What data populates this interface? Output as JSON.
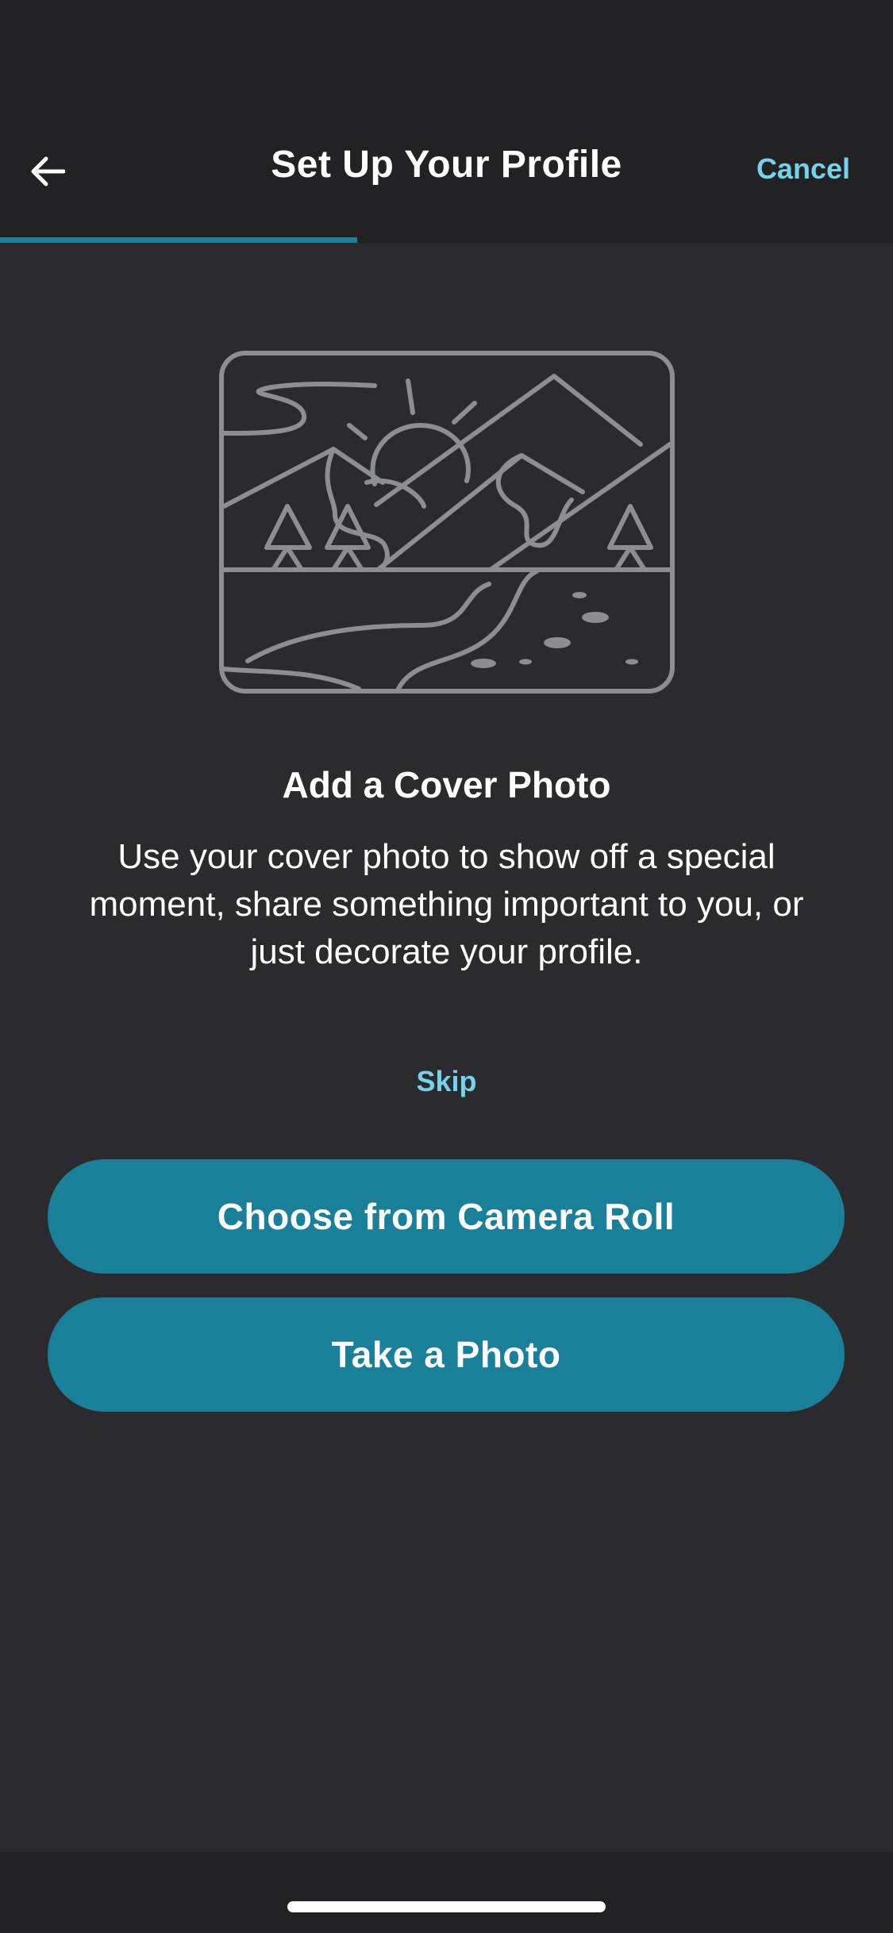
{
  "header": {
    "title": "Set Up Your Profile",
    "cancel_label": "Cancel",
    "back_icon": "arrow-left-icon"
  },
  "progress": {
    "fraction": 0.4
  },
  "illustration": {
    "icon": "landscape-photo-icon"
  },
  "main": {
    "title": "Add a Cover Photo",
    "description": "Use your cover photo to show off a special moment, share something important to you, or just decorate your profile.",
    "skip_label": "Skip"
  },
  "actions": {
    "camera_roll_label": "Choose from Camera Roll",
    "take_photo_label": "Take a Photo"
  },
  "colors": {
    "accent": "#1a8099",
    "link": "#74d3e8",
    "background": "#2b2b2f",
    "header_background": "#222224"
  }
}
